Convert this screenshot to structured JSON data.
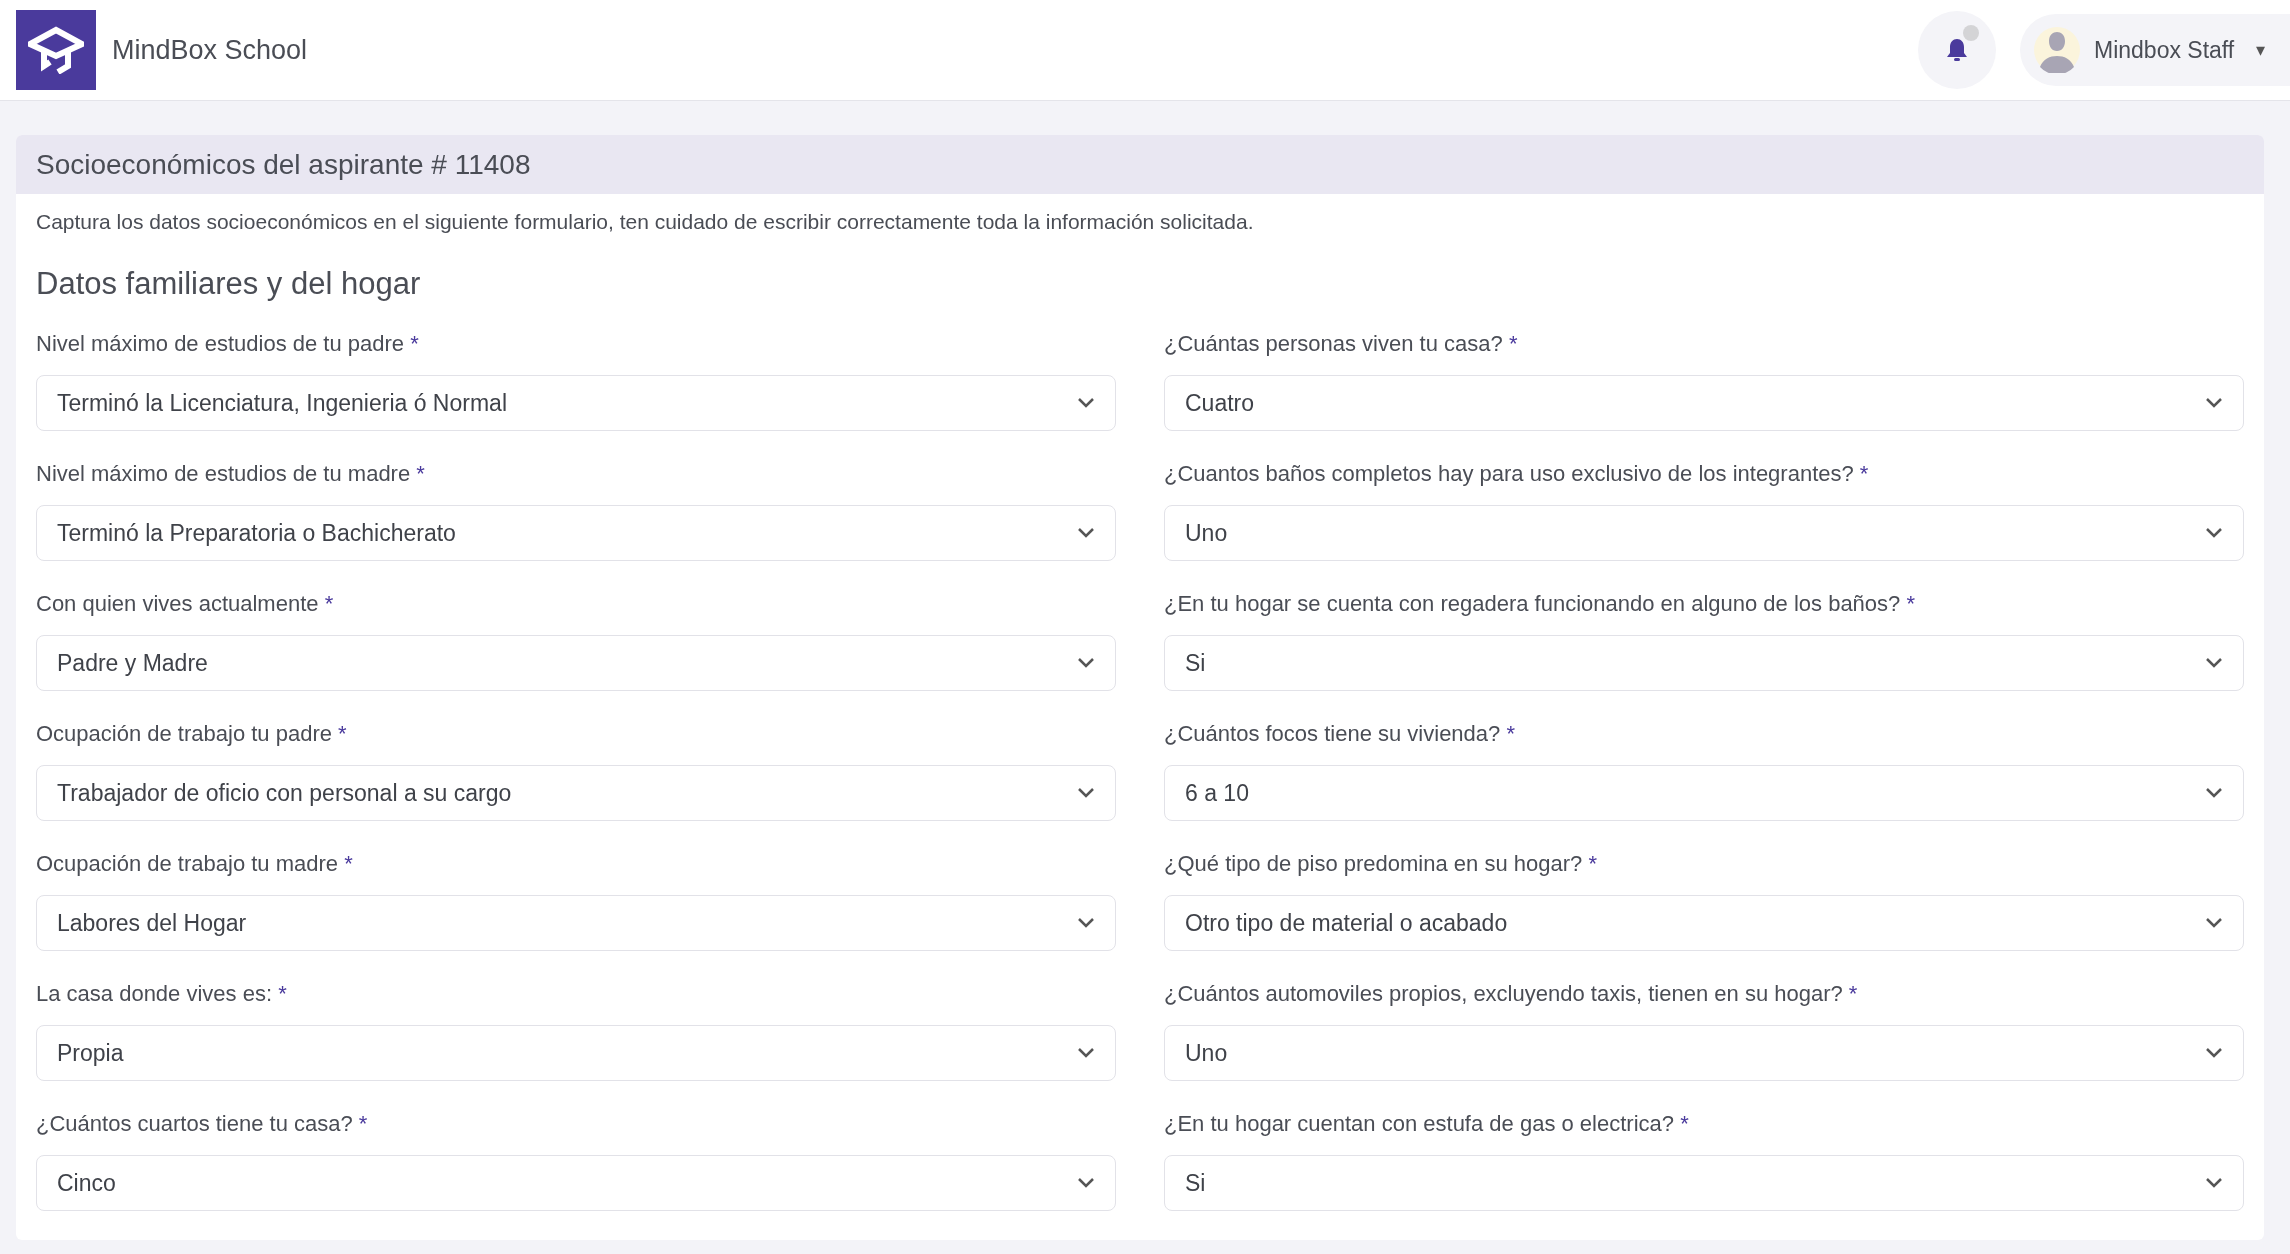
{
  "app": {
    "name": "MindBox School"
  },
  "user": {
    "name": "Mindbox Staff",
    "menu_icon": "▾"
  },
  "card": {
    "title": "Socioeconómicos del aspirante # 11408",
    "description": "Captura los datos socioeconómicos en el siguiente formulario, ten cuidado de escribir correctamente toda la información solicitada.",
    "section": "Datos familiares y del hogar",
    "fields": [
      {
        "label": "Nivel máximo de estudios de tu padre",
        "mark": "*",
        "value": "Terminó la Licenciatura, Ingenieria ó Normal"
      },
      {
        "label": "¿Cuántas personas viven tu casa?",
        "mark": "*",
        "value": "Cuatro"
      },
      {
        "label": "Nivel máximo de estudios de tu madre",
        "mark": "*",
        "value": "Terminó la Preparatoria o Bachicherato"
      },
      {
        "label": "¿Cuantos baños completos hay para uso exclusivo de los integrantes?",
        "mark": "*",
        "value": "Uno"
      },
      {
        "label": "Con quien vives actualmente",
        "mark": "*",
        "value": "Padre y Madre"
      },
      {
        "label": "¿En tu hogar se cuenta con regadera funcionando en alguno de los baños?",
        "mark": "*",
        "value": "Si"
      },
      {
        "label": "Ocupación de trabajo tu padre",
        "mark": "*",
        "value": "Trabajador de oficio con personal a su cargo"
      },
      {
        "label": "¿Cuántos focos tiene su vivienda?",
        "mark": "*",
        "value": "6 a 10"
      },
      {
        "label": "Ocupación de trabajo tu madre",
        "mark": "*",
        "value": "Labores del Hogar"
      },
      {
        "label": "¿Qué tipo de piso predomina en su hogar?",
        "mark": "*",
        "value": "Otro tipo de material o acabado"
      },
      {
        "label": "La casa donde vives es:",
        "mark": "*",
        "value": "Propia"
      },
      {
        "label": "¿Cuántos automoviles propios, excluyendo taxis, tienen en su hogar?",
        "mark": "*",
        "value": "Uno"
      },
      {
        "label": "¿Cuántos cuartos tiene tu casa?",
        "mark": "*",
        "value": "Cinco"
      },
      {
        "label": "¿En tu hogar cuentan con estufa de gas o electrica?",
        "mark": "*",
        "value": "Si"
      }
    ]
  }
}
